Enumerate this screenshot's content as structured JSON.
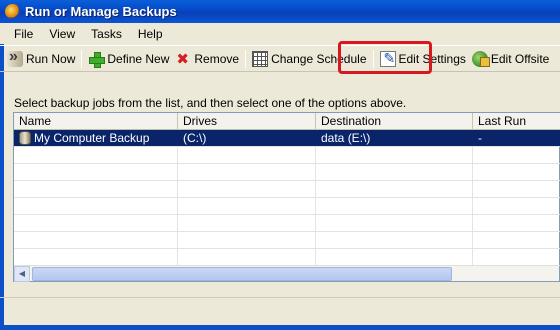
{
  "window": {
    "title": "Run or Manage Backups"
  },
  "menu": [
    {
      "label": "File"
    },
    {
      "label": "View"
    },
    {
      "label": "Tasks"
    },
    {
      "label": "Help"
    }
  ],
  "toolbar": {
    "run_now": "Run Now",
    "define_new": "Define New",
    "remove": "Remove",
    "change_schedule": "Change Schedule",
    "edit_settings": "Edit Settings",
    "edit_offsite": "Edit Offsite"
  },
  "instructions": "Select backup jobs from the list, and then select one of the options above.",
  "list": {
    "columns": [
      "Name",
      "Drives",
      "Destination",
      "Last Run"
    ],
    "rows": [
      {
        "name": "My Computer Backup",
        "drives": "(C:\\)",
        "destination": "data (E:\\)",
        "last_run": "-"
      }
    ]
  },
  "colors": {
    "title_bar": "#0447c7",
    "selection": "#0a246a",
    "highlight_box": "#d8181f"
  }
}
